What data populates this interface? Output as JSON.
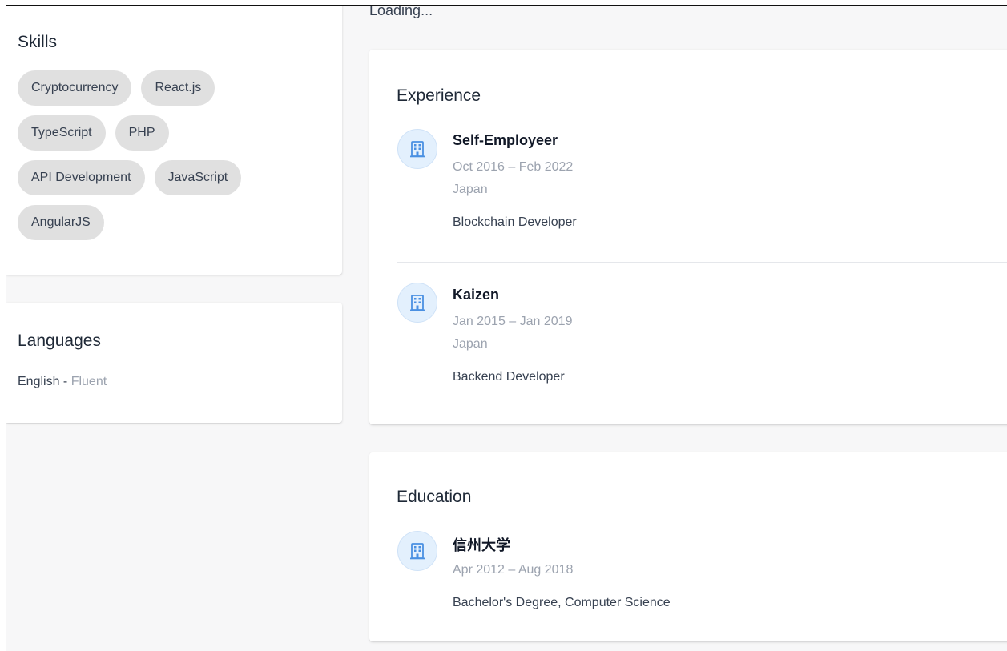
{
  "status": {
    "loading_text": "Loading..."
  },
  "skills": {
    "title": "Skills",
    "rows": [
      [
        "Cryptocurrency",
        "React.js"
      ],
      [
        "TypeScript",
        "PHP"
      ],
      [
        "API Development",
        "JavaScript"
      ],
      [
        "AngularJS"
      ]
    ]
  },
  "languages": {
    "title": "Languages",
    "items": [
      {
        "language": "English",
        "separator": " - ",
        "level": "Fluent"
      }
    ]
  },
  "experience": {
    "title": "Experience",
    "items": [
      {
        "company": "Self-Employeer",
        "dates": "Oct 2016 – Feb 2022",
        "location": "Japan",
        "role": "Blockchain Developer",
        "icon": "building-icon"
      },
      {
        "company": "Kaizen",
        "dates": "Jan 2015 – Jan 2019",
        "location": "Japan",
        "role": "Backend Developer",
        "icon": "building-icon"
      }
    ]
  },
  "education": {
    "title": "Education",
    "items": [
      {
        "school": "信州大学",
        "dates": "Apr 2012 – Aug 2018",
        "degree": "Bachelor's Degree, Computer Science",
        "icon": "building-icon"
      }
    ]
  },
  "colors": {
    "background": "#f7f7f8",
    "card": "#ffffff",
    "chip": "#e0e0e0",
    "icon_circle": "#e3f0fd",
    "icon_blue": "#4a90e2",
    "muted_text": "#9ca3af"
  }
}
